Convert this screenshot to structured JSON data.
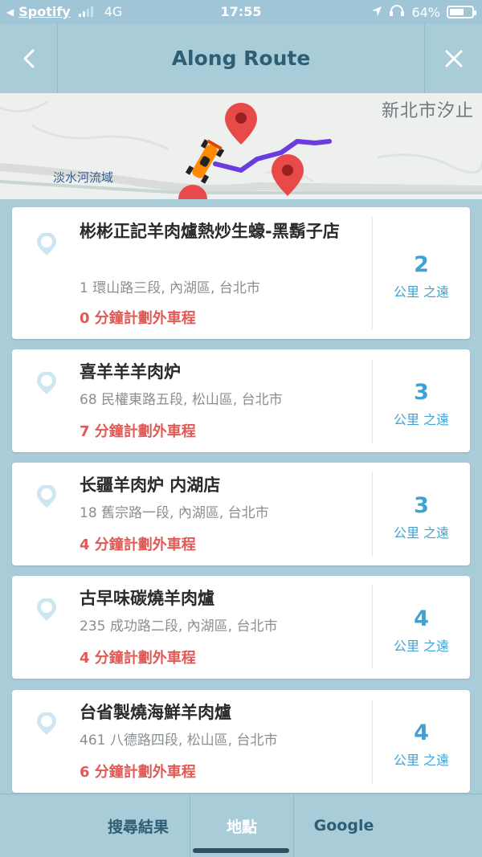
{
  "status_bar": {
    "back_app": "Spotify",
    "network": "4G",
    "time": "17:55",
    "battery": "64%",
    "battery_level": 0.64
  },
  "header": {
    "title": "Along Route"
  },
  "map": {
    "label_city": "新北市汐止",
    "label_river": "淡水河流域"
  },
  "results": [
    {
      "name": "彬彬正記羊肉爐熱炒生蠔-黑鬍子店",
      "address": "1 環山路三段, 內湖區, 台北市",
      "eta": "0 分鐘計劃外車程",
      "distance": "2",
      "unit": "公里 之遠"
    },
    {
      "name": "喜羊羊羊肉炉",
      "address": "68 民權東路五段, 松山區, 台北市",
      "eta": "7 分鐘計劃外車程",
      "distance": "3",
      "unit": "公里 之遠"
    },
    {
      "name": "长疆羊肉炉 内湖店",
      "address": "18 舊宗路一段, 內湖區, 台北市",
      "eta": "4 分鐘計劃外車程",
      "distance": "3",
      "unit": "公里 之遠"
    },
    {
      "name": "古早味碳燒羊肉爐",
      "address": "235 成功路二段, 內湖區, 台北市",
      "eta": "4 分鐘計劃外車程",
      "distance": "4",
      "unit": "公里 之遠"
    },
    {
      "name": "台省製燒海鮮羊肉爐",
      "address": "461 八德路四段, 松山區, 台北市",
      "eta": "6 分鐘計劃外車程",
      "distance": "4",
      "unit": "公里 之遠"
    }
  ],
  "tabs": {
    "search": "搜尋結果",
    "places": "地點",
    "google": "Google"
  },
  "colors": {
    "header_bg": "#a9ccd9",
    "title": "#2e5e73",
    "eta_red": "#e05a55",
    "distance_blue": "#3ea3d3",
    "route_purple": "#6a3be0",
    "pin_red": "#e84a4a"
  }
}
